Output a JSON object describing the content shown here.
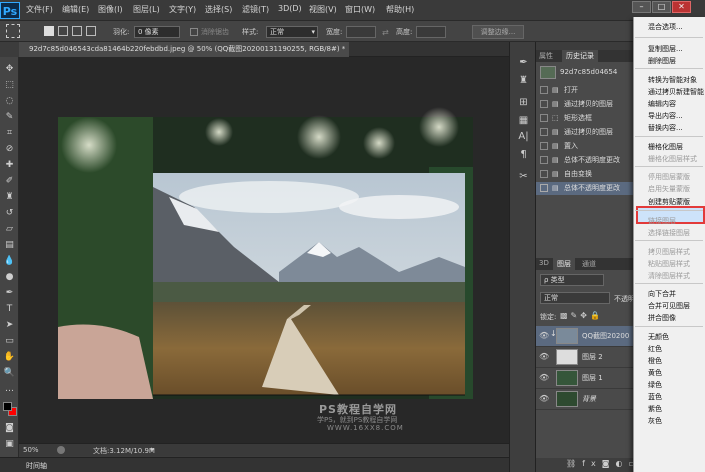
{
  "app": {
    "logo": "Ps"
  },
  "menus": [
    "文件(F)",
    "编辑(E)",
    "图像(I)",
    "图层(L)",
    "文字(Y)",
    "选择(S)",
    "滤镜(T)",
    "3D(D)",
    "视图(V)",
    "窗口(W)",
    "帮助(H)"
  ],
  "window_buttons": [
    "–",
    "□",
    "✕"
  ],
  "options": {
    "feather_label": "羽化:",
    "feather_value": "0 像素",
    "antialias_label": "消除锯齿",
    "style_label": "样式:",
    "style_value": "正常",
    "width_label": "宽度:",
    "height_label": "高度:",
    "refine_edge": "调整边缘..."
  },
  "document": {
    "tab_title": "92d7c85d046543cda81464b220febdbd.jpeg @ 50% (QQ截图20200131190255, RGB/8#) *",
    "zoom": "50%",
    "doc_size": "文档:3.12M/10.9M",
    "watermark_line1": "PS教程自学网",
    "watermark_line2": "学PS，就到PS教程自学网",
    "watermark_line3": "WWW.16XX8.COM"
  },
  "timeline_tab": "时间轴",
  "history": {
    "tabs": [
      "属性",
      "历史记录"
    ],
    "snapshot": "92d7c85d04654",
    "items": [
      "打开",
      "通过拷贝的图层",
      "矩形选框",
      "通过拷贝的图层",
      "置入",
      "总体不透明度更改",
      "自由变换",
      "总体不透明度更改"
    ]
  },
  "layers": {
    "tabs": [
      "3D",
      "图层",
      "通道"
    ],
    "filter_label": "ρ 类型",
    "blend_mode": "正常",
    "opacity_label": "不透明",
    "lock_label": "锁定:",
    "rows": [
      {
        "name": "QQ截图20200"
      },
      {
        "name": "图层 2"
      },
      {
        "name": "图层 1"
      },
      {
        "name": "背景"
      }
    ]
  },
  "context_menu": {
    "items": [
      {
        "label": "混合选项...",
        "enabled": true
      },
      {
        "label": "复制图层...",
        "enabled": true
      },
      {
        "label": "删除图层",
        "enabled": true
      },
      {
        "label": "转换为智能对象",
        "enabled": true
      },
      {
        "label": "通过拷贝新建智能",
        "enabled": true
      },
      {
        "label": "编辑内容",
        "enabled": true
      },
      {
        "label": "导出内容...",
        "enabled": true
      },
      {
        "label": "替换内容...",
        "enabled": true
      },
      {
        "label": "栅格化图层",
        "enabled": true
      },
      {
        "label": "栅格化图层样式",
        "enabled": false
      },
      {
        "label": "停用图层蒙版",
        "enabled": false
      },
      {
        "label": "启用矢量蒙版",
        "enabled": false
      },
      {
        "label": "创建剪贴蒙版",
        "enabled": true
      },
      {
        "label": "链接图层",
        "enabled": false
      },
      {
        "label": "选择链接图层",
        "enabled": false
      },
      {
        "label": "拷贝图层样式",
        "enabled": false
      },
      {
        "label": "粘贴图层样式",
        "enabled": false
      },
      {
        "label": "清除图层样式",
        "enabled": false
      },
      {
        "label": "向下合并",
        "enabled": true
      },
      {
        "label": "合并可见图层",
        "enabled": true
      },
      {
        "label": "拼合图像",
        "enabled": true
      },
      {
        "label": "无颜色",
        "enabled": true
      },
      {
        "label": "红色",
        "enabled": true
      },
      {
        "label": "橙色",
        "enabled": true
      },
      {
        "label": "黄色",
        "enabled": true
      },
      {
        "label": "绿色",
        "enabled": true
      },
      {
        "label": "蓝色",
        "enabled": true
      },
      {
        "label": "紫色",
        "enabled": true
      },
      {
        "label": "灰色",
        "enabled": true
      }
    ]
  },
  "colors": {
    "accent": "#31a8ff",
    "highlight_border": "#e23a3a",
    "foreground_swatch": "#000000",
    "background_swatch": "#ff0000"
  }
}
